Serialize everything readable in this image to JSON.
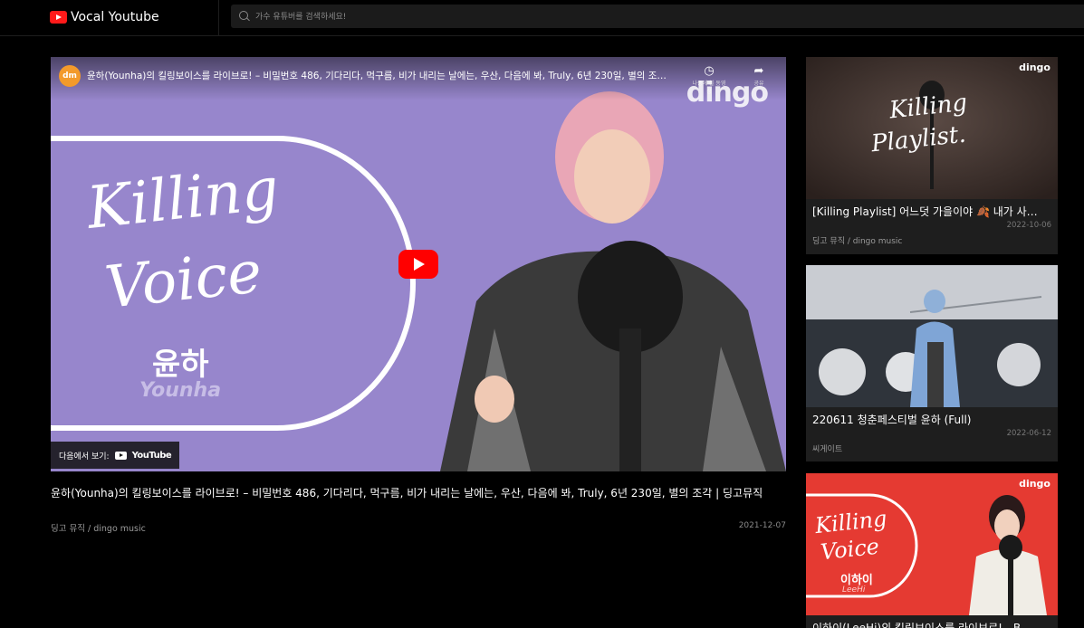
{
  "header": {
    "app_title": "Vocal Youtube",
    "search_placeholder": "가수 유튜버를 검색하세요!"
  },
  "player": {
    "channel_badge": "dm",
    "overlay_title": "윤하(Younha)의 킬링보이스를 라이브로! – 비밀번호 486, 기다리다, 먹구름, 비가 내리는 날에는, 우산, 다음에 봐, Truly, 6년 230일, 별의 조각...",
    "watch_later_label": "나중에 볼 동영상",
    "share_label": "공유",
    "watermark": "dingo",
    "thumb_title_line1": "Killing",
    "thumb_title_line2": "Voice",
    "thumb_artist_ko": "윤하",
    "thumb_artist_en": "Younha",
    "watch_on_label": "다음에서 보기:",
    "youtube_word": "YouTube"
  },
  "main_video": {
    "title": "윤하(Younha)의 킬링보이스를 라이브로! – 비밀번호 486, 기다리다, 먹구름, 비가 내리는 날에는, 우산, 다음에 봐, Truly, 6년 230일, 별의 조각 | 딩고뮤직",
    "channel": "딩고 뮤직 / dingo music",
    "date": "2021-12-07"
  },
  "sidebar": {
    "items": [
      {
        "thumb_logo": "dingo",
        "thumb_text_1": "Killing",
        "thumb_text_2": "Playlist.",
        "title": "[Killing Playlist] 어느덧 가을이야 🍂 내가 사…",
        "date": "2022-10-06",
        "channel": "딩고 뮤직 / dingo music"
      },
      {
        "title": "220611 청춘페스티벌 윤하 (Full)",
        "date": "2022-06-12",
        "channel": "씨게이트"
      },
      {
        "thumb_logo": "dingo",
        "thumb_text_1": "Killing",
        "thumb_text_2": "Voice",
        "thumb_artist_ko": "이하이",
        "thumb_artist_en": "LeeHi",
        "title": "이하이(LeeHi)의 킬링보이스를 라이브로! - B…"
      }
    ]
  }
}
